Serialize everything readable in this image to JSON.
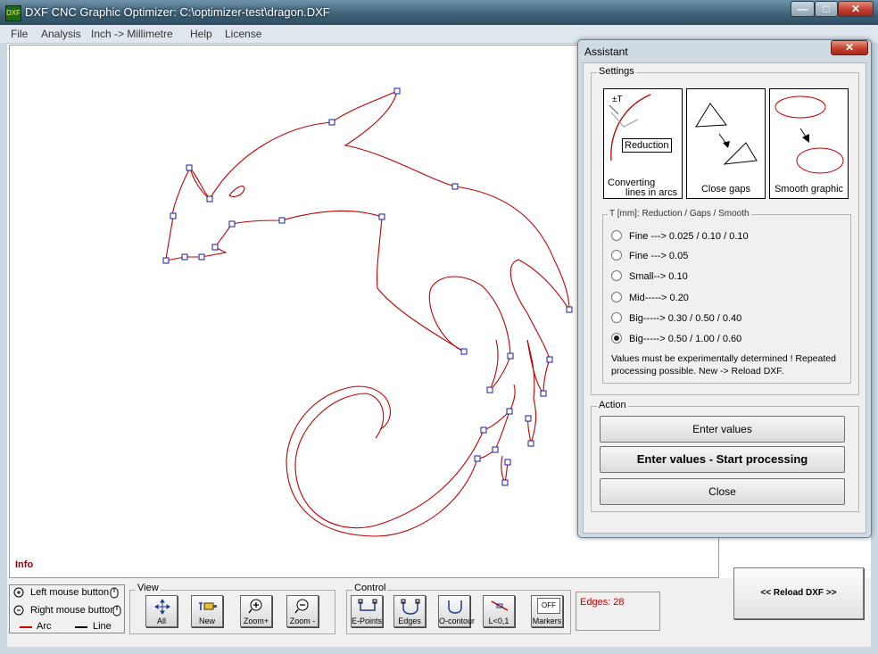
{
  "window": {
    "app_icon_text": "DXF",
    "title": "DXF CNC Graphic Optimizer: C:\\optimizer-test\\dragon.DXF",
    "minimize_label": "—",
    "maximize_label": "□",
    "close_label": "✕"
  },
  "menu": {
    "items": [
      {
        "label": "File"
      },
      {
        "label": "Analysis"
      },
      {
        "label": "Inch -> Millimetre"
      },
      {
        "label": "Help"
      },
      {
        "label": "License"
      }
    ]
  },
  "canvas": {
    "info_label": "Info",
    "curve_color": "#c00000",
    "marker_color": "#1a1aa8"
  },
  "legend": {
    "left_mouse": "Left mouse button",
    "right_mouse": "Right mouse button",
    "arc_label": "Arc",
    "line_label": "Line",
    "arc_color": "#cc0000",
    "line_color": "#000000"
  },
  "view_group": {
    "label": "View",
    "buttons": [
      {
        "label": "All",
        "icon": "fit-all-icon"
      },
      {
        "label": "New",
        "icon": "paint-new-icon"
      },
      {
        "label": "Zoom+",
        "icon": "zoom-in-icon"
      },
      {
        "label": "Zoom -",
        "icon": "zoom-out-icon"
      }
    ]
  },
  "control_group": {
    "label": "Control",
    "buttons": [
      {
        "label": "E-Points",
        "icon": "end-points-icon"
      },
      {
        "label": "Edges",
        "icon": "edges-icon"
      },
      {
        "label": "O-contour",
        "icon": "open-contour-icon"
      },
      {
        "label": "L<0,1",
        "icon": "short-line-icon"
      },
      {
        "label": "Markers",
        "icon": "markers-icon",
        "icon_text": "OFF"
      }
    ]
  },
  "edges_status": "Edges: 28",
  "reload_button": "<< Reload DXF  >>",
  "assistant": {
    "title": "Assistant",
    "close_label": "✕",
    "settings_label": "Settings",
    "cards": [
      {
        "label_line1": "Converting",
        "label_line2": "lines in arcs",
        "badge": "Reduction",
        "tolerance": "±T"
      },
      {
        "label_line1": "Close gaps"
      },
      {
        "label_line1": "Smooth graphic"
      }
    ],
    "tolerance_group_label": "T [mm]: Reduction / Gaps / Smooth",
    "options": [
      {
        "label": "Fine ---> 0.025 / 0.10 / 0.10",
        "checked": false
      },
      {
        "label": "Fine ---> 0.05",
        "checked": false
      },
      {
        "label": "Small--> 0.10",
        "checked": false
      },
      {
        "label": "Mid-----> 0.20",
        "checked": false
      },
      {
        "label": "Big-----> 0.30 /  0.50 / 0.40",
        "checked": false
      },
      {
        "label": "Big-----> 0.50 / 1.00 / 0.60",
        "checked": true
      }
    ],
    "note": "Values must be experimentally determined ! Repeated processing possible. New -> Reload DXF.",
    "action_label": "Action",
    "btn_enter_values": "Enter values",
    "btn_start": "Enter values - Start processing",
    "btn_close": "Close"
  }
}
